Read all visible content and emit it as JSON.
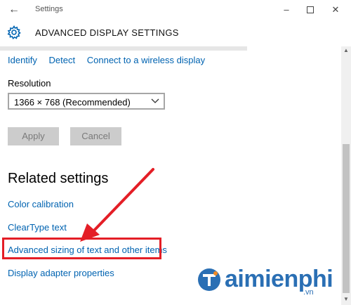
{
  "window": {
    "title": "Settings",
    "back_icon": "arrow-left-icon",
    "minimize_icon": "minimize-icon",
    "maximize_icon": "maximize-icon",
    "close_icon": "close-icon"
  },
  "header": {
    "icon": "gear-icon",
    "title": "ADVANCED DISPLAY SETTINGS"
  },
  "display_links": {
    "identify": "Identify",
    "detect": "Detect",
    "connect": "Connect to a wireless display"
  },
  "resolution": {
    "label": "Resolution",
    "value": "1366 × 768 (Recommended)"
  },
  "buttons": {
    "apply": "Apply",
    "cancel": "Cancel"
  },
  "related": {
    "heading": "Related settings",
    "items": [
      "Color calibration",
      "ClearType text",
      "Advanced sizing of text and other items",
      "Display adapter properties"
    ]
  },
  "watermark": {
    "brand": "aimienphi",
    "suffix": ".vn"
  },
  "colors": {
    "link": "#0063b1",
    "annotation": "#e41e26",
    "brand": "#2a6fb4"
  }
}
